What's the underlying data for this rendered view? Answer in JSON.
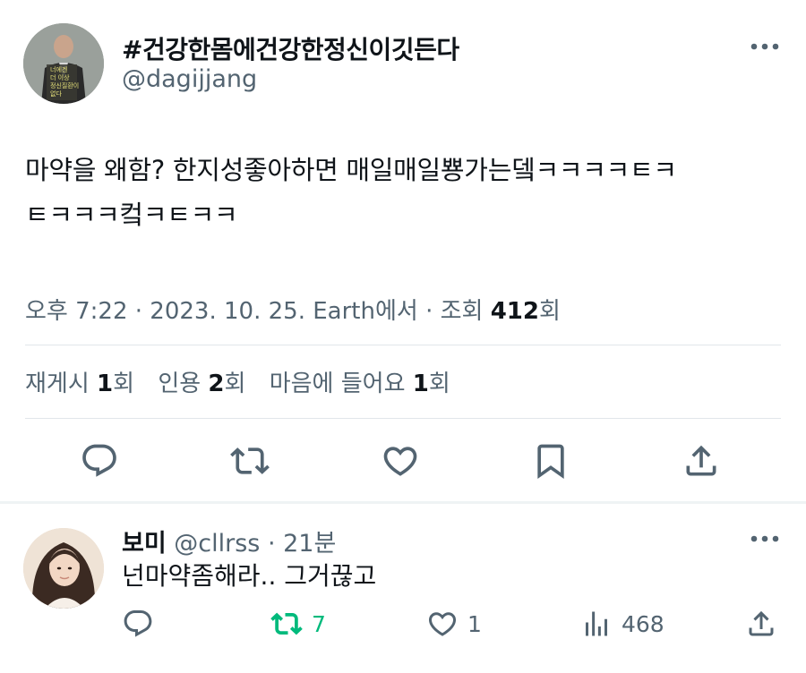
{
  "tweet": {
    "author_name": "#건강한몸에건강한정신이깃든다",
    "author_handle": "@dagijjang",
    "avatar_caption_lines": [
      "너에겐",
      "더 이상",
      "정신질환이",
      "없다"
    ],
    "text_line1": "마약을 왜함? 한지성좋아하면 매일매일뿅가는뎈ㅋㅋㅋㅋㅌㅋ",
    "text_line2": "ㅌㅋㅋㅋ컼ㅋㅌㅋㅋ",
    "time": "오후 7:22",
    "date": "2023. 10. 25.",
    "source": "Earth에서",
    "views_label": "조회",
    "views_count": "412",
    "views_suffix": "회",
    "stats": {
      "retweets_label": "재게시",
      "retweets_count": "1",
      "quotes_label": "인용",
      "quotes_count": "2",
      "likes_label": "마음에 들어요",
      "likes_count": "1",
      "suffix": "회"
    },
    "actions": [
      "reply-icon",
      "retweet-icon",
      "heart-icon",
      "bookmark-icon",
      "share-icon"
    ]
  },
  "reply": {
    "author_name": "보미",
    "author_handle": "@cllrss",
    "time_ago": "21분",
    "text": "넌마약좀해라.. 그거끊고",
    "retweet_count": "7",
    "like_count": "1",
    "view_count": "468"
  },
  "colors": {
    "text": "#0f1419",
    "muted": "#536471",
    "retweet_active": "#00ba7c",
    "divider": "#e1e6ea"
  }
}
